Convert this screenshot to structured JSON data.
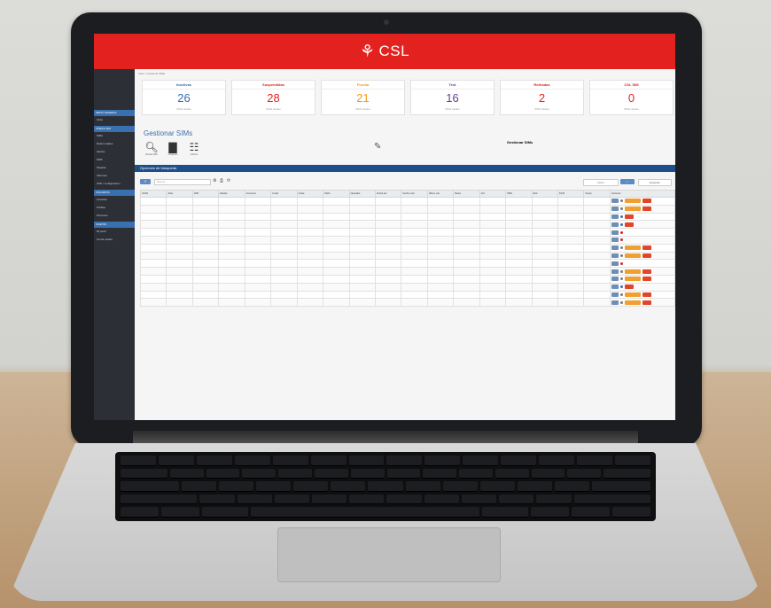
{
  "brand": {
    "logo_icon": "csl-logo-icon",
    "name": "CSL",
    "bar_color": "#e3221f"
  },
  "breadcrumb": "Inicio / Gestionar SIMs",
  "sidebar": {
    "sections": [
      {
        "label": "MENÚ GENERAL",
        "items": [
          "Inicio"
        ]
      },
      {
        "label": "LÍNEAS SIM",
        "items": [
          "SIMs",
          "Datos usados",
          "Alertas",
          "SMS",
          "Tarjetas",
          "Informes",
          "APN / configuración"
        ]
      },
      {
        "label": "USUARIOS",
        "items": [
          "Usuarios",
          "Perfiles",
          "Permisos"
        ]
      },
      {
        "label": "CUENTA",
        "items": [
          "Mi perfil",
          "Cerrar sesión"
        ]
      }
    ]
  },
  "stats": [
    {
      "label": "Inactivas",
      "value": "26",
      "sub": "SIMs totales",
      "color": "#2f6fb3"
    },
    {
      "label": "Suspendidas",
      "value": "28",
      "sub": "SIMs totales",
      "color": "#e3221f"
    },
    {
      "label": "Prueba",
      "value": "21",
      "sub": "SIMs totales",
      "color": "#f09a1a"
    },
    {
      "label": "Test",
      "value": "16",
      "sub": "SIMs totales",
      "color": "#6b3a8f"
    },
    {
      "label": "Retiradas",
      "value": "2",
      "sub": "SIMs totales",
      "color": "#e3221f"
    },
    {
      "label": "CSL SIM",
      "value": "0",
      "sub": "SIMs totales",
      "color": "#e3221f"
    }
  ],
  "page": {
    "title": "Gestionar SIMs",
    "section_title": "Opciones de búsqueda"
  },
  "tools": [
    {
      "icon": "search-icon",
      "label": "Buscar SIM"
    },
    {
      "icon": "chart-icon",
      "label": "Consumo"
    },
    {
      "icon": "document-icon",
      "label": "Informe"
    }
  ],
  "info": {
    "icon": "edit-icon",
    "title": "Gestionar SIMs",
    "text": ""
  },
  "controls": {
    "search_placeholder": "Buscar...",
    "filter_label": "Filtrar",
    "export_label": "Exportar"
  },
  "table": {
    "columns": [
      "ICCID",
      "Alias",
      "APN",
      "Estado",
      "Consumo",
      "Límite",
      "Coste",
      "Tarifa",
      "Operador",
      "Fecha act.",
      "Fecha mod.",
      "Último uso",
      "Datos",
      "Voz",
      "SMS",
      "Red",
      "Perfil",
      "Grupo",
      "Acciones"
    ],
    "rows": [
      {
        "status_color": "#7a7a7a",
        "orange": true,
        "red": true
      },
      {
        "status_color": "#7a7a7a",
        "orange": true,
        "red": true
      },
      {
        "status_color": "#3a6fb0",
        "orange": false,
        "red": true
      },
      {
        "status_color": "#3a6fb0",
        "orange": false,
        "red": true
      },
      {
        "status_color": "#e3221f",
        "orange": false,
        "red": false
      },
      {
        "status_color": "#e3221f",
        "orange": false,
        "red": false
      },
      {
        "status_color": "#7a7a7a",
        "orange": true,
        "red": true
      },
      {
        "status_color": "#7a7a7a",
        "orange": true,
        "red": true
      },
      {
        "status_color": "#e3221f",
        "orange": false,
        "red": false
      },
      {
        "status_color": "#7a7a7a",
        "orange": true,
        "red": true
      },
      {
        "status_color": "#7a7a7a",
        "orange": true,
        "red": true
      },
      {
        "status_color": "#3a6fb0",
        "orange": false,
        "red": true
      },
      {
        "status_color": "#7a7a7a",
        "orange": true,
        "red": true
      },
      {
        "status_color": "#7a7a7a",
        "orange": true,
        "red": true
      }
    ]
  }
}
